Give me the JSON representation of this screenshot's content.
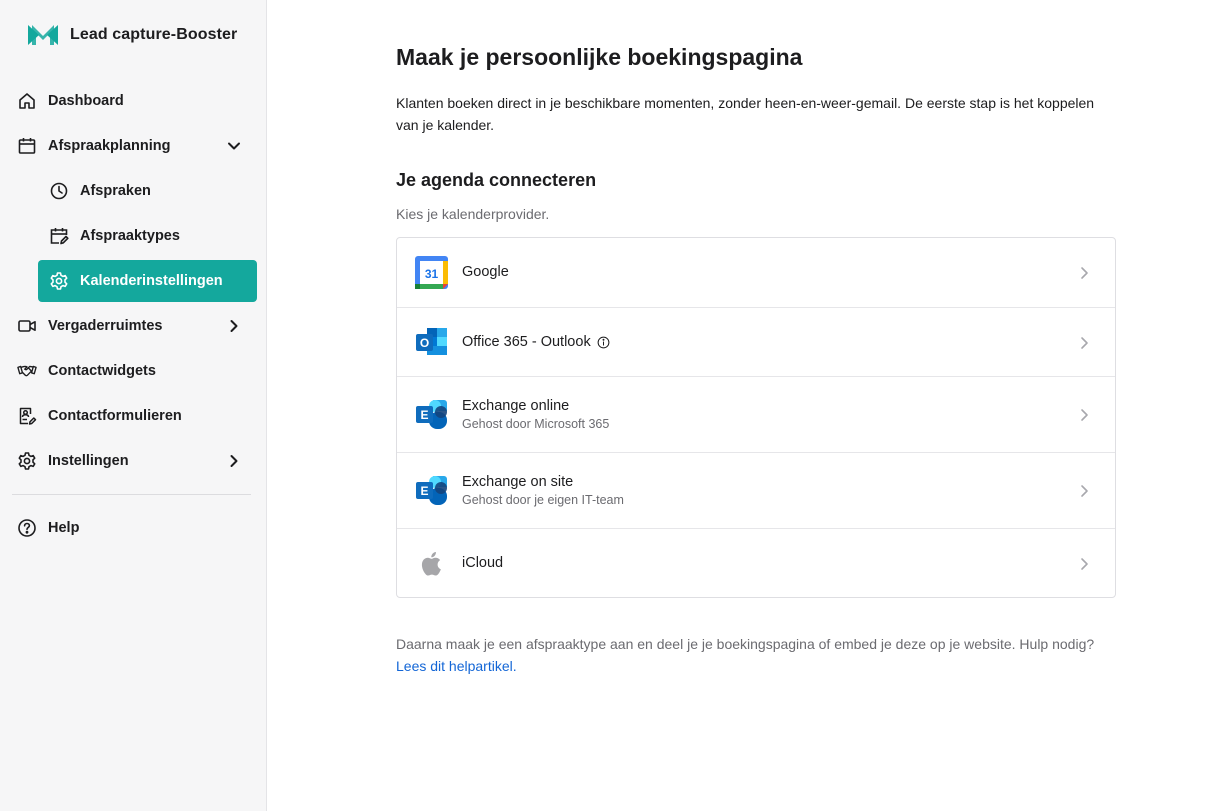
{
  "brand": {
    "name": "Lead capture-Booster",
    "color": "#14a89d"
  },
  "sidebar": {
    "items": [
      {
        "label": "Dashboard",
        "icon": "home-icon"
      },
      {
        "label": "Afspraakplanning",
        "icon": "calendar-icon",
        "expanded": true
      },
      {
        "label": "Afspraken",
        "icon": "clock-icon"
      },
      {
        "label": "Afspraaktypes",
        "icon": "calendar-edit-icon"
      },
      {
        "label": "Kalenderinstellingen",
        "icon": "gear-icon",
        "active": true
      },
      {
        "label": "Vergaderruimtes",
        "icon": "video-icon"
      },
      {
        "label": "Contactwidgets",
        "icon": "handshake-icon"
      },
      {
        "label": "Contactformulieren",
        "icon": "form-icon"
      },
      {
        "label": "Instellingen",
        "icon": "gear-icon"
      },
      {
        "label": "Help",
        "icon": "help-icon"
      }
    ]
  },
  "main": {
    "title": "Maak je persoonlijke boekingspagina",
    "intro": "Klanten boeken direct in je beschikbare momenten, zonder heen-en-weer-gemail. De eerste stap is het koppelen van je kalender.",
    "section_title": "Je agenda connecteren",
    "section_sub": "Kies je kalenderprovider.",
    "providers": [
      {
        "name": "Google",
        "sub": "",
        "icon": "google-calendar-icon"
      },
      {
        "name": "Office 365 - Outlook",
        "sub": "",
        "icon": "outlook-icon",
        "info": true
      },
      {
        "name": "Exchange online",
        "sub": "Gehost door Microsoft 365",
        "icon": "exchange-icon"
      },
      {
        "name": "Exchange on site",
        "sub": "Gehost door je eigen IT-team",
        "icon": "exchange-icon"
      },
      {
        "name": "iCloud",
        "sub": "",
        "icon": "apple-icon"
      }
    ],
    "footer_text": "Daarna maak je een afspraaktype aan en deel je je boekingspagina of embed je deze op je website. Hulp nodig?",
    "footer_link": "Lees dit helpartikel."
  },
  "colors": {
    "accent": "#14a89d",
    "link": "#1366d6",
    "muted": "#6b6b70"
  }
}
